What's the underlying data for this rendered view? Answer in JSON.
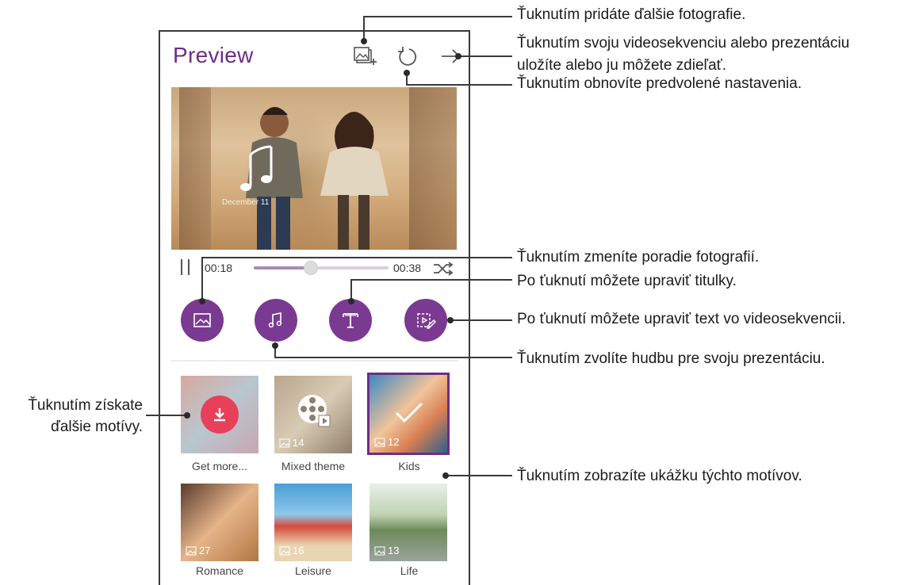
{
  "app": {
    "title": "Preview"
  },
  "toolbar": {
    "icons": [
      "add-photo-icon",
      "reset-icon",
      "share-arrow-icon"
    ]
  },
  "preview": {
    "date_caption": "December 11"
  },
  "player": {
    "current_time": "00:18",
    "total_time": "00:38",
    "progress": 0.42
  },
  "actions": [
    "reorder-photos-icon",
    "music-note-icon",
    "text-title-icon",
    "edit-video-text-icon"
  ],
  "themes": [
    {
      "label": "Get more...",
      "count": ""
    },
    {
      "label": "Mixed theme",
      "count": "14"
    },
    {
      "label": "Kids",
      "count": "12",
      "selected": true
    },
    {
      "label": "Romance",
      "count": "27"
    },
    {
      "label": "Leisure",
      "count": "16"
    },
    {
      "label": "Life",
      "count": "13"
    }
  ],
  "annotations": {
    "add_photos": "Ťuknutím pridáte ďalšie fotografie.",
    "save_share_1": "Ťuknutím svoju videosekvenciu alebo prezentáciu",
    "save_share_2": "uložíte alebo ju môžete zdieľať.",
    "reset": "Ťuknutím obnovíte predvolené nastavenia.",
    "reorder": "Ťuknutím zmeníte poradie fotografií.",
    "subtitles": "Po ťuknutí môžete upraviť titulky.",
    "video_text": "Po ťuknutí môžete upraviť text vo videosekvencii.",
    "music": "Ťuknutím zvolíte hudbu pre svoju prezentáciu.",
    "more_themes_1": "Ťuknutím získate",
    "more_themes_2": "ďalšie motívy.",
    "theme_preview": "Ťuknutím zobrazíte ukážku týchto motívov."
  },
  "colors": {
    "accent": "#6d2d86",
    "button": "#7a3a92",
    "download": "#e8405a"
  }
}
